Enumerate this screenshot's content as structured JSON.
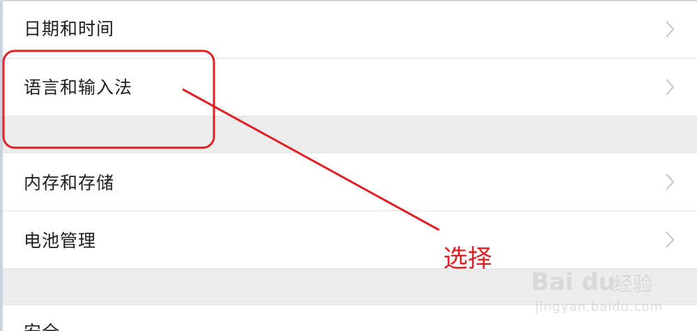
{
  "settings": {
    "items": [
      {
        "label": "日期和时间"
      },
      {
        "label": "语言和输入法"
      },
      {
        "label": "内存和存储"
      },
      {
        "label": "电池管理"
      },
      {
        "label": "安全"
      }
    ]
  },
  "annotation": {
    "label": "选择",
    "color": "#e01e24"
  },
  "watermark": {
    "logo": "Bai du",
    "brand": "经验",
    "url": "jingyan.baidu.com"
  }
}
